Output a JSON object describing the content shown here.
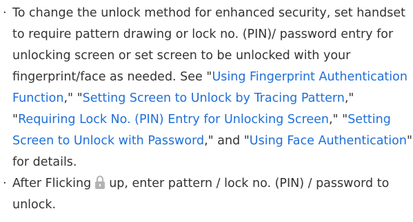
{
  "bullet_char": "·",
  "para1": {
    "t1": "To change the unlock method for enhanced security, set handset to require pattern drawing or lock no. (PIN)/ password entry for unlocking screen or set screen to be unlocked with your fingerprint/face as needed. See \"",
    "link1": "Using Fingerprint Authentication Function",
    "t2": ",\" \"",
    "link2": "Setting Screen to Unlock by Tracing Pattern",
    "t3": ",\" \"",
    "link3": "Requiring Lock No. (PIN) Entry for Unlocking Screen",
    "t4": ",\" \"",
    "link4": "Setting Screen to Unlock with Password",
    "t5": ",\" and \"",
    "link5": "Using Face Authentication",
    "t6": "\" for details."
  },
  "para2": {
    "t1": "After Flicking",
    "icon": "lock-icon",
    "t2": "up, enter pattern / lock no. (PIN) / password to unlock."
  },
  "colors": {
    "text": "#333333",
    "link": "#1e6fd9",
    "icon": "#b3b3b3"
  }
}
